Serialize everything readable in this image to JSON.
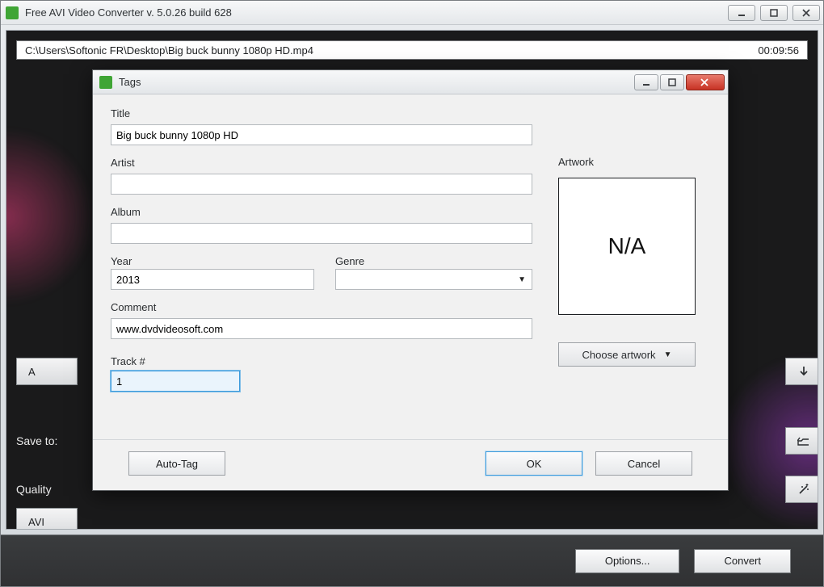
{
  "main": {
    "title": "Free AVI Video Converter  v. 5.0.26 build 628",
    "file_path": "C:\\Users\\Softonic FR\\Desktop\\Big buck bunny 1080p HD.mp4",
    "duration": "00:09:56",
    "add_label": "A",
    "saveto_label": "Save to:",
    "quality_label": "Quality",
    "avi_label": "AVI",
    "options_label": "Options...",
    "convert_label": "Convert"
  },
  "dialog": {
    "window_title": "Tags",
    "labels": {
      "title": "Title",
      "artist": "Artist",
      "album": "Album",
      "year": "Year",
      "genre": "Genre",
      "comment": "Comment",
      "track": "Track #",
      "artwork": "Artwork"
    },
    "values": {
      "title": "Big buck bunny 1080p HD",
      "artist": "",
      "album": "",
      "year": "2013",
      "genre": "",
      "comment": "www.dvdvideosoft.com",
      "track": "1",
      "artwork_text": "N/A"
    },
    "buttons": {
      "choose_artwork": "Choose artwork",
      "auto_tag": "Auto-Tag",
      "ok": "OK",
      "cancel": "Cancel"
    }
  }
}
